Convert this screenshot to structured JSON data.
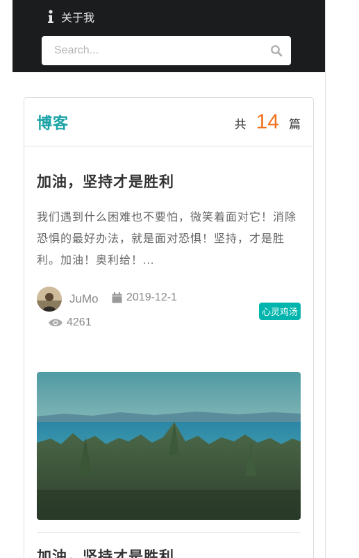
{
  "nav": {
    "about_label": "关于我",
    "search_placeholder": "Search...",
    "search_icon": "search-icon",
    "about_icon": "info-icon"
  },
  "blog": {
    "title": "博客",
    "count_prefix": "共",
    "count": "14",
    "count_suffix": "篇"
  },
  "posts": [
    {
      "title": "加油，坚持才是胜利",
      "excerpt": "我们遇到什么困难也不要怕，微笑着面对它！消除恐惧的最好办法，就是面对恐惧！坚持，才是胜利。加油！奥利给！...",
      "author": "JuMo",
      "date": "2019-12-1",
      "views": "4261",
      "tag": "心灵鸡汤"
    },
    {
      "title": "加油，坚持才是胜利"
    }
  ],
  "colors": {
    "nav_bg": "#1b1c1d",
    "accent_teal": "#1aa3a6",
    "count_orange": "#f2711c",
    "tag_bg": "#00b5ad"
  }
}
